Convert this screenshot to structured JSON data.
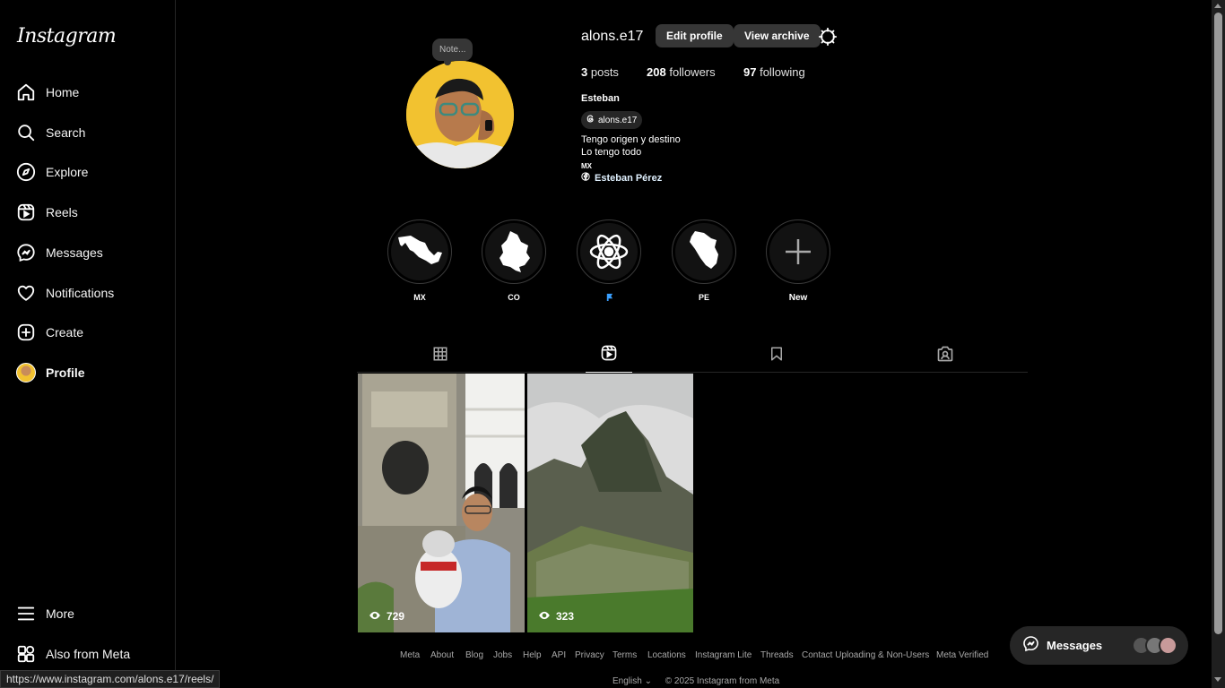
{
  "app": {
    "logo_text": "Instagram"
  },
  "sidebar": {
    "items": [
      {
        "label": "Home",
        "icon": "home-icon"
      },
      {
        "label": "Search",
        "icon": "search-icon"
      },
      {
        "label": "Explore",
        "icon": "explore-icon"
      },
      {
        "label": "Reels",
        "icon": "reels-icon"
      },
      {
        "label": "Messages",
        "icon": "messenger-icon"
      },
      {
        "label": "Notifications",
        "icon": "heart-icon"
      },
      {
        "label": "Create",
        "icon": "plus-square-icon"
      },
      {
        "label": "Profile",
        "icon": "avatar",
        "active": true
      }
    ],
    "more_label": "More",
    "meta_label": "Also from Meta"
  },
  "profile": {
    "note_label": "Note...",
    "username": "alons.e17",
    "edit_label": "Edit profile",
    "archive_label": "View archive",
    "stats": {
      "posts_count": "3",
      "posts_label": "posts",
      "followers_count": "208",
      "followers_label": "followers",
      "following_count": "97",
      "following_label": "following"
    },
    "full_name": "Esteban",
    "threads_handle": "alons.e17",
    "bio_line1": "Tengo origen y destino",
    "bio_line2": "Lo tengo todo",
    "bio_line3": "MX",
    "link_label": "Esteban Pérez"
  },
  "highlights": [
    {
      "label": "MX",
      "icon": "mexico-map-icon"
    },
    {
      "label": "CO",
      "icon": "colombia-map-icon"
    },
    {
      "label": "",
      "icon": "atom-icon",
      "label_icon": "blue-flag-icon"
    },
    {
      "label": "PE",
      "icon": "peru-map-icon"
    },
    {
      "label": "New",
      "icon": "plus-icon"
    }
  ],
  "tabs": [
    {
      "name": "posts",
      "icon": "grid-icon"
    },
    {
      "name": "reels",
      "icon": "reels-icon",
      "active": true
    },
    {
      "name": "saved",
      "icon": "bookmark-icon"
    },
    {
      "name": "tagged",
      "icon": "tagged-icon"
    }
  ],
  "reels": [
    {
      "views": "729",
      "scene": "man with plush dog in plaza"
    },
    {
      "views": "323",
      "scene": "mountain ruins"
    }
  ],
  "footer": {
    "links": [
      "Meta",
      "About",
      "Blog",
      "Jobs",
      "Help",
      "API",
      "Privacy",
      "Terms",
      "Locations",
      "Instagram Lite",
      "Threads",
      "Contact Uploading & Non-Users",
      "Meta Verified"
    ],
    "language": "English",
    "copyright": "© 2025 Instagram from Meta"
  },
  "messages_bubble": {
    "label": "Messages"
  },
  "status_url": "https://www.instagram.com/alons.e17/reels/",
  "colors": {
    "background": "#000000",
    "button": "#363636",
    "text": "#f5f5f5",
    "muted": "#a8a8a8"
  }
}
